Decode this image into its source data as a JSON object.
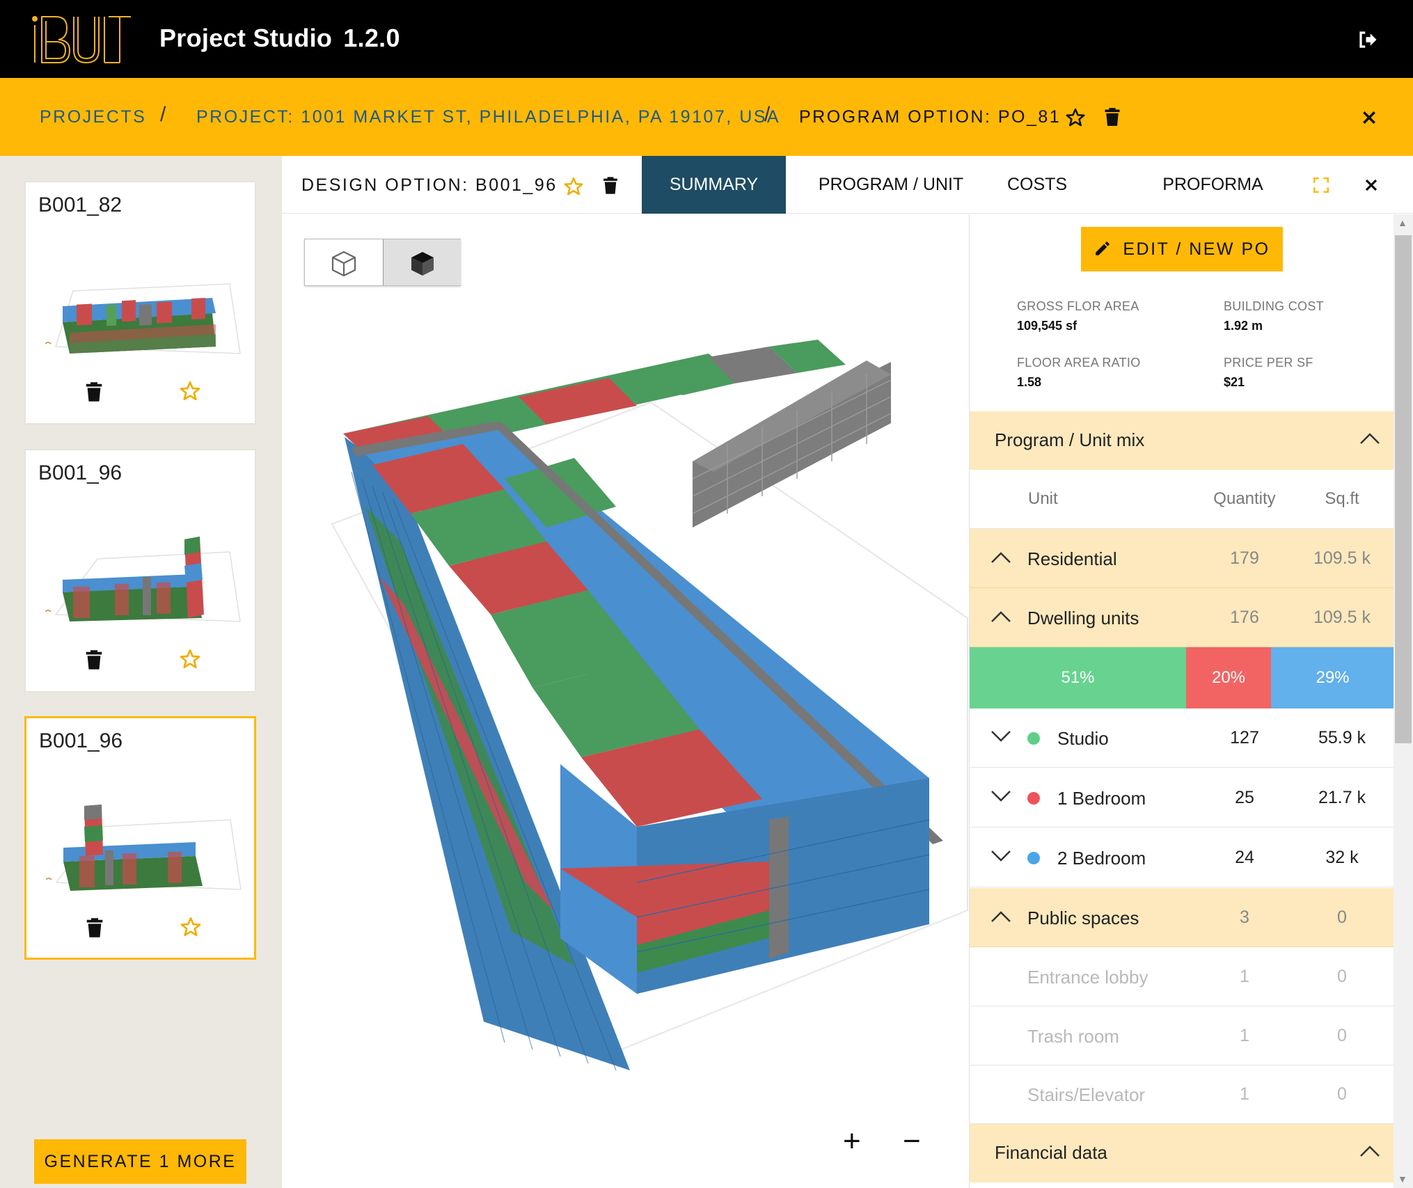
{
  "app": {
    "title": "Project Studio",
    "version": "1.2.0"
  },
  "breadcrumb": {
    "projects": "PROJECTS",
    "separator": "/",
    "project": "PROJECT: 1001 MARKET ST, PHILADELPHIA, PA 19107, USA",
    "program_option": "PROGRAM OPTION: PO_81"
  },
  "options": [
    {
      "label": "B001_82"
    },
    {
      "label": "B001_96"
    },
    {
      "label": "B001_96"
    }
  ],
  "generate_label": "GENERATE 1 MORE",
  "design_option": "DESIGN OPTION: B001_96",
  "tabs": [
    "SUMMARY",
    "PROGRAM / UNIT MIX",
    "COSTS",
    "PROFORMA"
  ],
  "zoom": {
    "in": "+",
    "out": "−"
  },
  "panel": {
    "edit_label": "EDIT / NEW PO",
    "stats": [
      {
        "label": "GROSS FLOR AREA",
        "value": "109,545 sf"
      },
      {
        "label": "BUILDING COST",
        "value": "1.92 m"
      },
      {
        "label": "FLOOR AREA RATIO",
        "value": "1.58"
      },
      {
        "label": "PRICE PER SF",
        "value": "$21"
      }
    ],
    "program_section": "Program / Unit mix",
    "columns": {
      "unit": "Unit",
      "quantity": "Quantity",
      "sqft": "Sq.ft"
    },
    "residential": {
      "name": "Residential",
      "quantity": "179",
      "sqft": "109.5 k"
    },
    "dwelling": {
      "name": "Dwelling units",
      "quantity": "176",
      "sqft": "109.5 k"
    },
    "mix": [
      {
        "label": "51%",
        "value": 51,
        "color": "#68d391"
      },
      {
        "label": "20%",
        "value": 20,
        "color": "#f26464"
      },
      {
        "label": "29%",
        "value": 29,
        "color": "#62b0ec"
      }
    ],
    "units": [
      {
        "name": "Studio",
        "quantity": "127",
        "sqft": "55.9 k",
        "color": "#5ecf89"
      },
      {
        "name": "1 Bedroom",
        "quantity": "25",
        "sqft": "21.7 k",
        "color": "#f0525b"
      },
      {
        "name": "2 Bedroom",
        "quantity": "24",
        "sqft": "32 k",
        "color": "#4aa5e8"
      }
    ],
    "public": {
      "name": "Public spaces",
      "quantity": "3",
      "sqft": "0"
    },
    "public_items": [
      {
        "name": "Entrance lobby",
        "quantity": "1",
        "sqft": "0"
      },
      {
        "name": "Trash room",
        "quantity": "1",
        "sqft": "0"
      },
      {
        "name": "Stairs/Elevator",
        "quantity": "1",
        "sqft": "0"
      }
    ],
    "financial_section": "Financial data"
  },
  "colors": {
    "accent": "#ffb805",
    "active_tab": "#1e4c64",
    "link": "#1f5a85",
    "studio": "#4ea162",
    "one_bed": "#c95050",
    "two_bed": "#4e8dc4",
    "core": "#7a7a7a"
  }
}
